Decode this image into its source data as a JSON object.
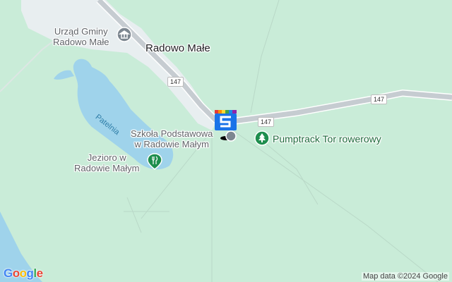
{
  "map": {
    "town_label": "Radowo Małe",
    "pois": [
      {
        "name": "Urząd Gminy Radowo Małe",
        "line1": "Urząd Gminy",
        "line2": "Radowo Małe",
        "icon": "town-hall-icon"
      },
      {
        "name": "Szkoła Podstawowa w Radowie Małym",
        "line1": "Szkoła Podstawowa",
        "line2": "w Radowie Małym",
        "icon": "school-icon"
      },
      {
        "name": "Jezioro w Radowie Małym",
        "line1": "Jezioro w",
        "line2": "Radowie Małym",
        "icon": "restaurant-icon"
      },
      {
        "name": "Pumptrack Tor rowerowy",
        "line1": "Pumptrack Tor rowerowy",
        "icon": "park-tree-icon"
      }
    ],
    "water_label": "Patelnia",
    "road_shields": [
      "147",
      "147",
      "147"
    ],
    "attribution": "Map data ©2024 Google",
    "logo": [
      "G",
      "o",
      "o",
      "g",
      "l",
      "e"
    ],
    "colors": {
      "land": "#c9ecd8",
      "water": "#9fd3eb",
      "road": "#c6ccd1",
      "urban": "#e9eef0",
      "poi_green": "#1e8e4e",
      "poi_gray": "#7d8790",
      "marker_blue": "#1a73e8",
      "logo_blue": "#4285f4",
      "logo_red": "#ea4335",
      "logo_yellow": "#fbbc05",
      "logo_green": "#34a853"
    }
  }
}
